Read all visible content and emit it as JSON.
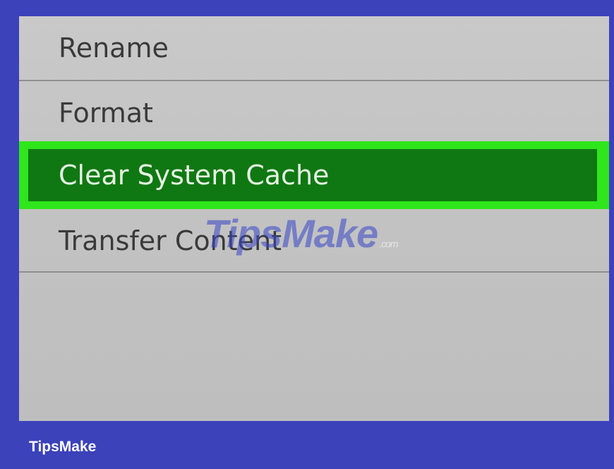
{
  "menu": {
    "items": [
      {
        "label": "Rename"
      },
      {
        "label": "Format"
      },
      {
        "label": "Clear System Cache"
      },
      {
        "label": "Transfer Content"
      }
    ],
    "selected_index": 2
  },
  "watermark": {
    "text": "TipsMake",
    "suffix": ".com"
  },
  "footer": {
    "brand": "TipsMake"
  },
  "colors": {
    "background": "#3b42ba",
    "panel": "#c6c6c6",
    "selection_border": "#2ee61b",
    "selection_fill": "#0f7812",
    "text": "#3a3a3a"
  }
}
